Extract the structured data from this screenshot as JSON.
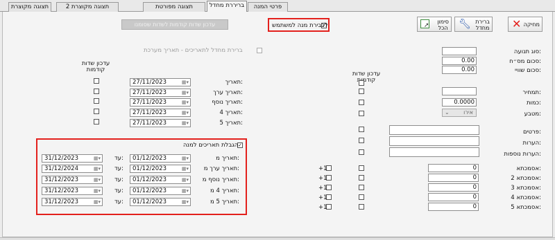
{
  "tabs": [
    {
      "label": "פרטי המנה"
    },
    {
      "label": "בריררת מחדל"
    },
    {
      "label": "תצוגה מפורטת"
    },
    {
      "label": "תצוגה מקוצרת 2"
    },
    {
      "label": "תצוגה מקוצרת"
    }
  ],
  "toolbar": {
    "cancel_label": "מחיקה",
    "default_label": "ברירת\nמחדל",
    "select_all_label": "סימון\nהכל"
  },
  "user_default_label": "לכבירת מנה למשתמש",
  "update_button_label": "עדכון שדות קודמות לשדות שסומנו",
  "default_dates_label": "ברירת מחדל לתאריכים - תאריך מערכת",
  "col_header_right": "עדכון שדות\nקודמות",
  "col_header_left": "עדכון שדות\nקודמות",
  "fields": {
    "movement_type": "סוג תנועה:",
    "total_before_vat": "סכום מס״ח:",
    "total_net": "סכום שוויי:",
    "price": "תמחיר:",
    "quantity": "כמות:",
    "currency": "מטבע:",
    "details": "פרטים:",
    "remarks": "הערות:",
    "extra_remarks": "הערות נוספות:",
    "values": {
      "total_before_vat": "0.00",
      "total_net": "0.00",
      "quantity": "0.0000",
      "currency": "אירו"
    }
  },
  "asmachtot": [
    {
      "label": "אסמכתא:",
      "value": "0",
      "plus": "+1"
    },
    {
      "label": "אסמכתא 2:",
      "value": "0",
      "plus": "+1"
    },
    {
      "label": "אסמכתא 3:",
      "value": "0",
      "plus": "+1"
    },
    {
      "label": "אסמכתא 4:",
      "value": "0",
      "plus": "+1"
    },
    {
      "label": "אסמכתא 5:",
      "value": "0",
      "plus": "+1"
    }
  ],
  "dates": [
    {
      "label": "תאריך:",
      "value": "27/11/2023"
    },
    {
      "label": "תאריך ערך:",
      "value": "27/11/2023"
    },
    {
      "label": "תאריך נוסף:",
      "value": "27/11/2023"
    },
    {
      "label": "תאריך 4:",
      "value": "27/11/2023"
    },
    {
      "label": "תאריך 5:",
      "value": "27/11/2023"
    }
  ],
  "limits": {
    "title": "הגבלת תאריכים למנה",
    "to_label": "עד:",
    "rows": [
      {
        "label": "תאריך מ:",
        "from": "01/12/2023",
        "to": "31/12/2023"
      },
      {
        "label": "תאריך ערך מ:",
        "from": "01/12/2023",
        "to": "31/12/2024"
      },
      {
        "label": "תאריך נוסף מ:",
        "from": "01/12/2023",
        "to": "31/12/2023"
      },
      {
        "label": "תאריך 4 מ:",
        "from": "01/12/2023",
        "to": "31/12/2023"
      },
      {
        "label": "תאריך 5 מ:",
        "from": "01/12/2023",
        "to": "31/12/2023"
      }
    ]
  },
  "colors": {
    "highlight": "#e3201c",
    "panel": "#f4f4f4"
  }
}
